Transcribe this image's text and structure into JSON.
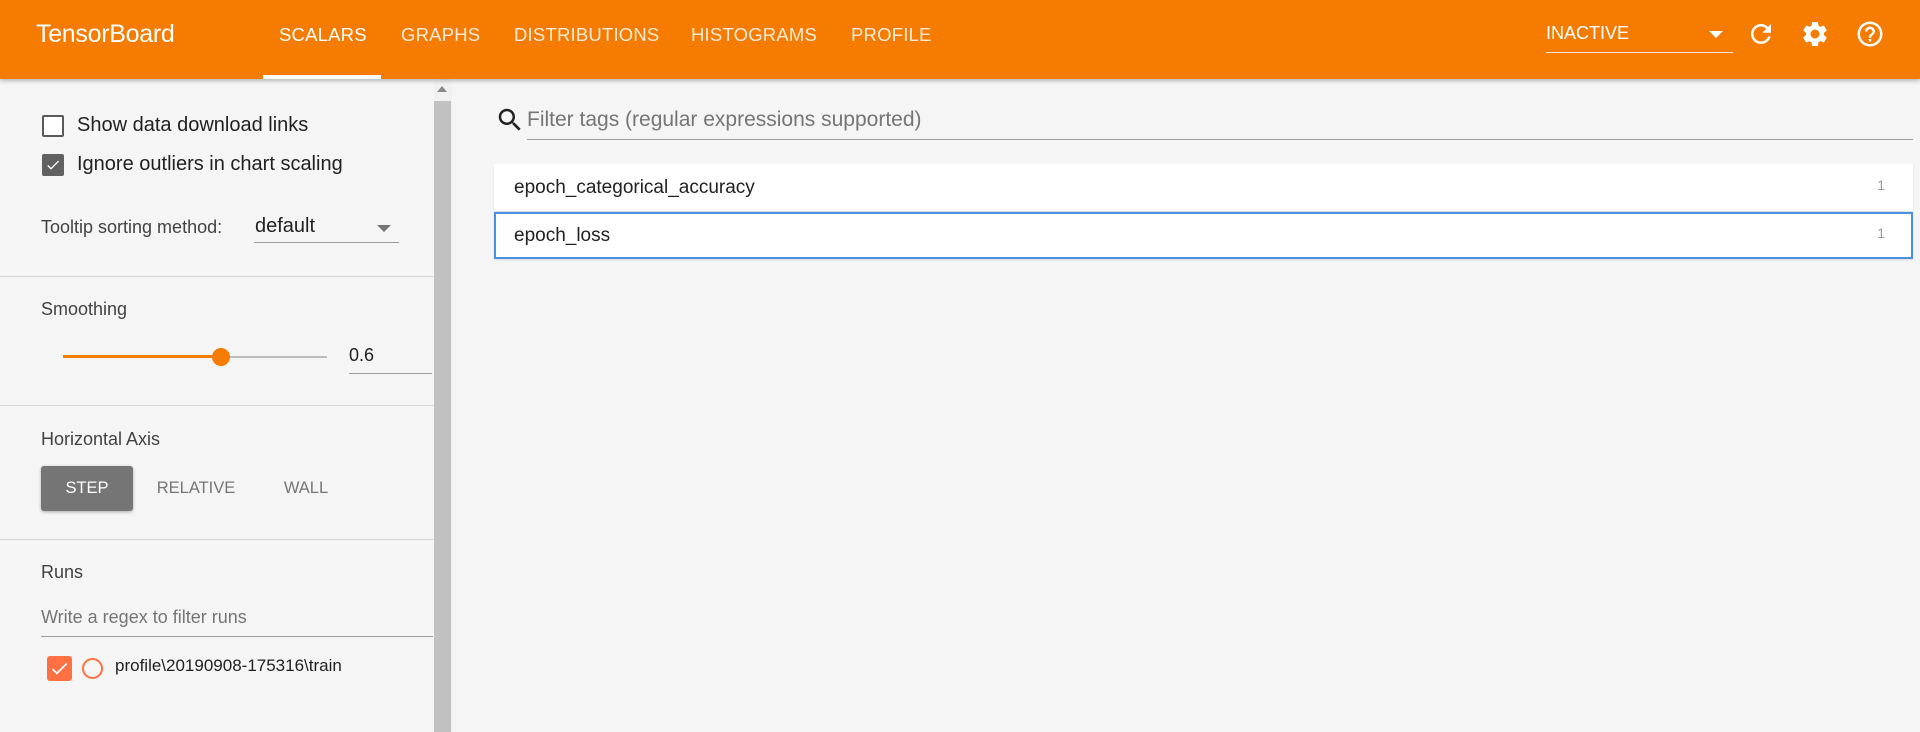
{
  "app": {
    "title": "TensorBoard"
  },
  "nav": {
    "tabs": [
      {
        "label": "SCALARS",
        "active": true
      },
      {
        "label": "GRAPHS",
        "active": false
      },
      {
        "label": "DISTRIBUTIONS",
        "active": false
      },
      {
        "label": "HISTOGRAMS",
        "active": false
      },
      {
        "label": "PROFILE",
        "active": false
      }
    ],
    "run_status": "INACTIVE",
    "icons": [
      "refresh-icon",
      "settings-gear-icon",
      "help-icon"
    ]
  },
  "sidebar": {
    "show_download_links": {
      "label": "Show data download links",
      "checked": false
    },
    "ignore_outliers": {
      "label": "Ignore outliers in chart scaling",
      "checked": true
    },
    "tooltip_sorting": {
      "label": "Tooltip sorting method:",
      "value": "default"
    },
    "smoothing": {
      "label": "Smoothing",
      "value": "0.6",
      "level": 0.6
    },
    "horizontal_axis": {
      "label": "Horizontal Axis",
      "options": [
        {
          "label": "STEP",
          "active": true
        },
        {
          "label": "RELATIVE",
          "active": false
        },
        {
          "label": "WALL",
          "active": false
        }
      ]
    },
    "runs": {
      "label": "Runs",
      "filter_placeholder": "Write a regex to filter runs",
      "items": [
        {
          "name": "profile\\20190908-175316\\train",
          "checked": true,
          "color": "#ff7043"
        }
      ]
    }
  },
  "main": {
    "filter_placeholder": "Filter tags (regular expressions supported)",
    "tags": [
      {
        "name": "epoch_categorical_accuracy",
        "count": "1"
      },
      {
        "name": "epoch_loss",
        "count": "1"
      }
    ]
  },
  "colors": {
    "accent": "#f57c00",
    "run": "#ff7043",
    "focus": "#4a90e2"
  }
}
